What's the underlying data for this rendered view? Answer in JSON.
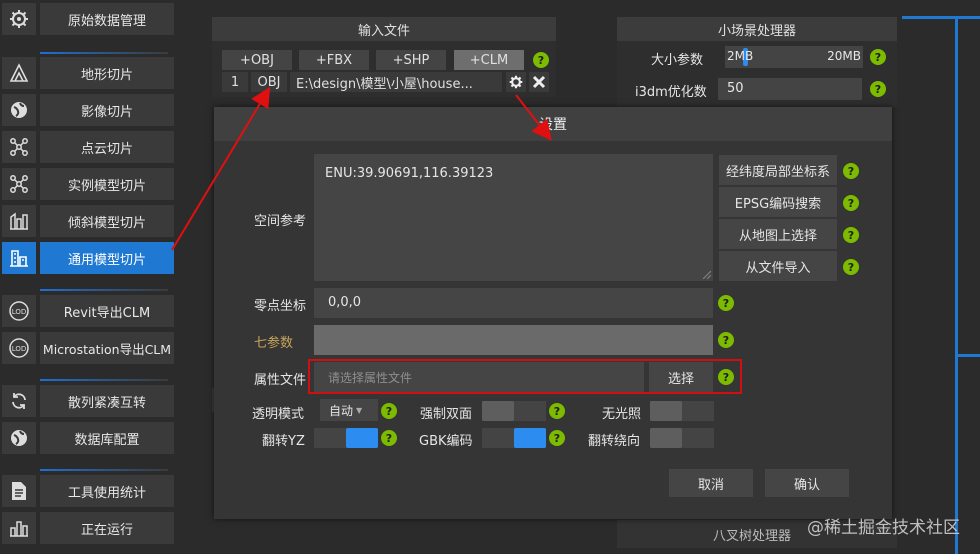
{
  "sidebar": {
    "items": [
      {
        "label": "原始数据管理",
        "icon": "gear-icon"
      },
      {
        "label": "地形切片",
        "icon": "terrain-icon"
      },
      {
        "label": "影像切片",
        "icon": "globe-icon"
      },
      {
        "label": "点云切片",
        "icon": "pointcloud-icon"
      },
      {
        "label": "实例模型切片",
        "icon": "instance-icon"
      },
      {
        "label": "倾斜模型切片",
        "icon": "oblique-icon"
      },
      {
        "label": "通用模型切片",
        "icon": "model-icon"
      },
      {
        "label": "Revit导出CLM",
        "icon": "lod-icon"
      },
      {
        "label": "Microstation导出CLM",
        "icon": "lod-icon"
      },
      {
        "label": "散列紧凑互转",
        "icon": "refresh-icon"
      },
      {
        "label": "数据库配置",
        "icon": "globe-icon"
      },
      {
        "label": "工具使用统计",
        "icon": "document-icon"
      },
      {
        "label": "正在运行",
        "icon": "chart-icon"
      }
    ],
    "active_index": 6
  },
  "input_panel": {
    "title": "输入文件",
    "buttons": [
      "+OBJ",
      "+FBX",
      "+SHP",
      "+CLM"
    ],
    "row": {
      "index": "1",
      "type": "OBJ",
      "path": "E:\\design\\模型\\小屋\\house..."
    }
  },
  "scene_panel": {
    "title": "小场景处理器",
    "size_label": "大小参数",
    "size_min": "2MB",
    "size_max": "20MB",
    "i3dm_label": "i3dm优化数",
    "i3dm_value": "50"
  },
  "octree_label": "八叉树处理器",
  "dialog": {
    "title": "设置",
    "spatial_ref_label": "空间参考",
    "spatial_ref_value": "ENU:39.90691,116.39123",
    "ref_buttons": [
      "经纬度局部坐标系",
      "EPSG编码搜索",
      "从地图上选择",
      "从文件导入"
    ],
    "zero_label": "零点坐标",
    "zero_value": "0,0,0",
    "seven_label": "七参数",
    "attr_label": "属性文件",
    "attr_placeholder": "请选择属性文件",
    "attr_button": "选择",
    "transparent_label": "透明模式",
    "transparent_value": "自动",
    "double_side_label": "强制双面",
    "no_light_label": "无光照",
    "flip_yz_label": "翻转YZ",
    "gbk_label": "GBK编码",
    "flip_wind_label": "翻转绕向",
    "cancel": "取消",
    "confirm": "确认"
  },
  "watermark": "@稀土掘金技术社区",
  "colors": {
    "accent": "#1f78d1",
    "help": "#7cbb00",
    "highlight": "#d01010",
    "clm": "#6e6e6e"
  }
}
